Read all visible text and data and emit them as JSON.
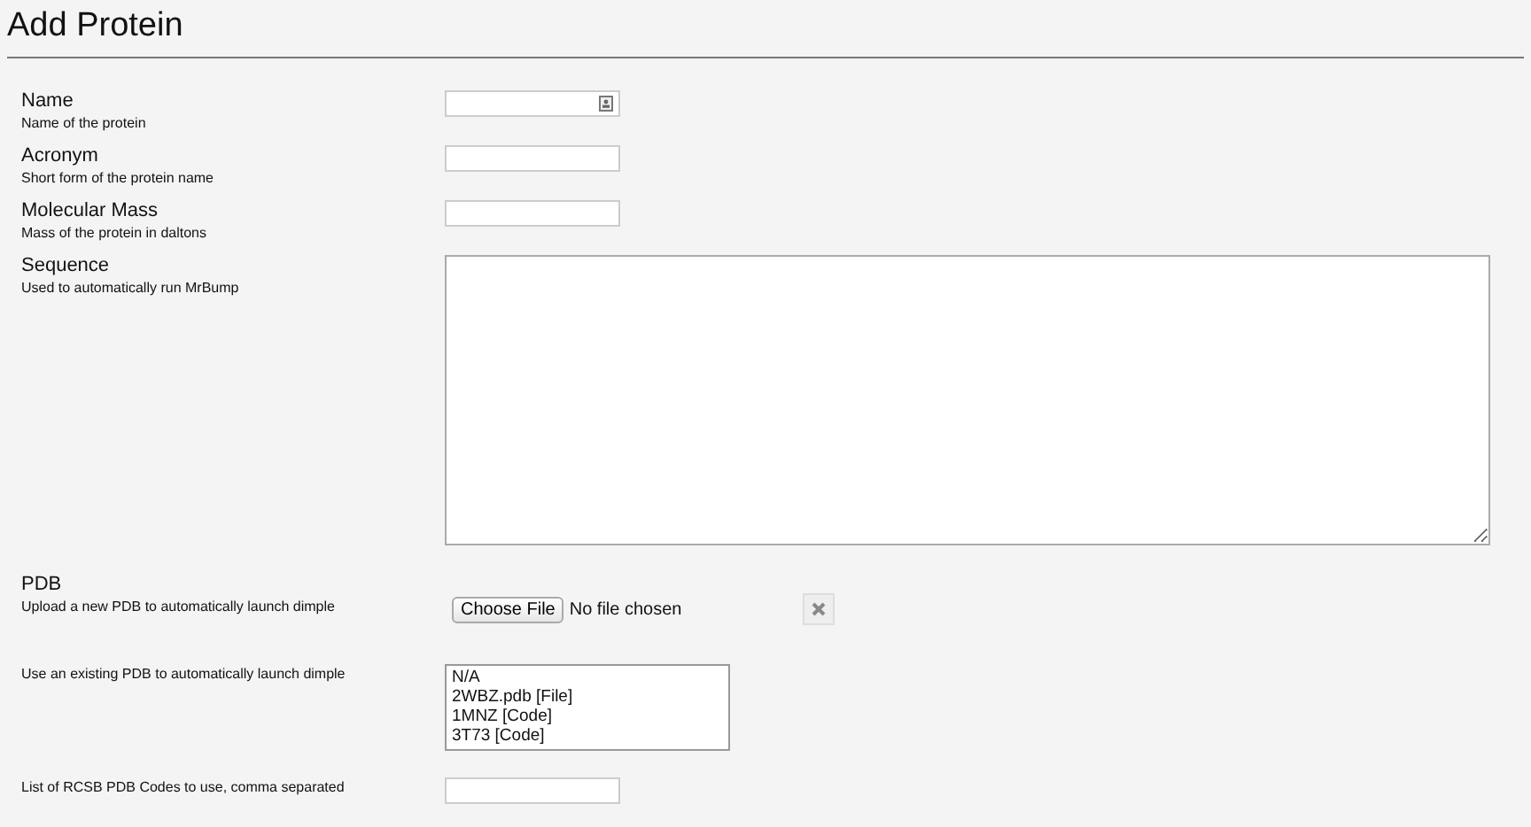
{
  "title": "Add Protein",
  "fields": [
    {
      "kind": "text",
      "label": "Name",
      "description": "Name of the protein",
      "autofill_icon": true
    },
    {
      "kind": "text",
      "label": "Acronym",
      "description": "Short form of the protein name"
    },
    {
      "kind": "text",
      "label": "Molecular Mass",
      "description": "Mass of the protein in daltons"
    },
    {
      "kind": "textarea",
      "label": "Sequence",
      "description": "Used to automatically run MrBump"
    },
    {
      "kind": "file",
      "label": "PDB",
      "description": "Upload a new PDB to automatically launch dimple",
      "button": "Choose File",
      "status": "No file chosen"
    },
    {
      "kind": "select",
      "description": "Use an existing PDB to automatically launch dimple",
      "options": [
        "N/A",
        "2WBZ.pdb [File]",
        "1MNZ [Code]",
        "3T73 [Code]"
      ]
    },
    {
      "kind": "text",
      "description": "List of RCSB PDB Codes to use, comma separated"
    }
  ]
}
